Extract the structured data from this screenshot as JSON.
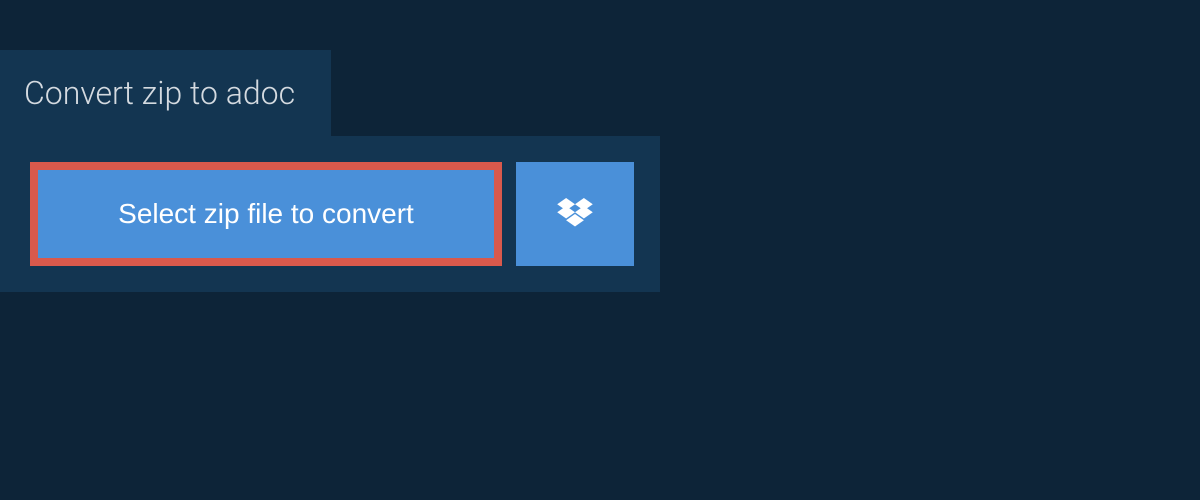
{
  "tab": {
    "title": "Convert zip to adoc"
  },
  "actions": {
    "select_file_label": "Select zip file to convert"
  },
  "colors": {
    "background": "#0d2438",
    "panel": "#133551",
    "button": "#4a90d9",
    "highlight_border": "#d9594c"
  }
}
